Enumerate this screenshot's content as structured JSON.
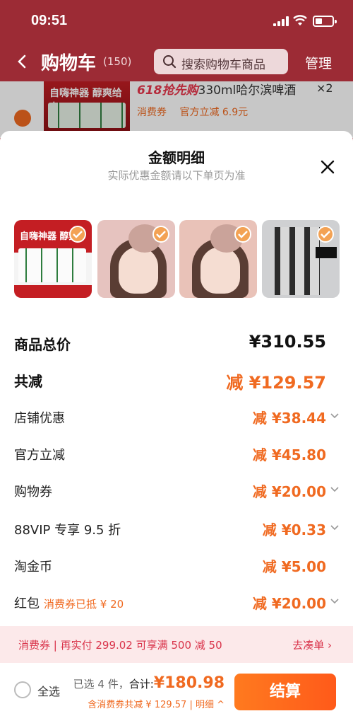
{
  "status_bar": {
    "time": "09:51"
  },
  "nav": {
    "title": "购物车",
    "count": "(150)",
    "search_placeholder": "搜索购物车商品",
    "manage": "管理"
  },
  "background_item": {
    "promo": "618抢先购",
    "title": "330ml哈尔滨啤酒",
    "qty": "×2",
    "tags": [
      "消费券",
      "官方立减 6.9元"
    ],
    "thumb_text": "自嗨神器 醇爽给力"
  },
  "sheet": {
    "title": "金额明细",
    "subtitle": "实际优惠金额请以下单页为准"
  },
  "thumbnails": [
    {
      "name": "beer",
      "text": "自嗨神器 醇爽"
    },
    {
      "name": "makeup-1",
      "text": ""
    },
    {
      "name": "makeup-2",
      "text": ""
    },
    {
      "name": "pens",
      "text": ""
    }
  ],
  "rows": [
    {
      "label": "商品总价",
      "value": "¥310.55",
      "style": "total"
    },
    {
      "label": "共减",
      "value": "减 ¥129.57",
      "style": "big"
    },
    {
      "label": "店铺优惠",
      "value": "减 ¥38.44",
      "chevron": true
    },
    {
      "label": "官方立减",
      "value": "减 ¥45.80",
      "chevron": false
    },
    {
      "label": "购物券",
      "value": "减 ¥20.00",
      "chevron": true
    },
    {
      "label": "88VIP 专享 9.5 折",
      "value": "减 ¥0.33",
      "chevron": true
    },
    {
      "label": "淘金币",
      "value": "减 ¥5.00",
      "chevron": false
    },
    {
      "label": "红包",
      "sub": "消费券已抵 ¥ 20",
      "value": "减 ¥20.00",
      "chevron": true
    }
  ],
  "notice": {
    "text": "消费券 | 再实付 299.02 可享满 500 减 50",
    "link": "去凑单 ›"
  },
  "bottom": {
    "select_all": "全选",
    "selected": "已选 4 件，",
    "total_label": "合计:",
    "total": "¥180.98",
    "discount_line": "含消费券共减 ¥ 129.57 | 明细 ^",
    "checkout": "结算"
  },
  "colors": {
    "accent": "#f06a21",
    "brand_bg": "#9c2b35"
  }
}
